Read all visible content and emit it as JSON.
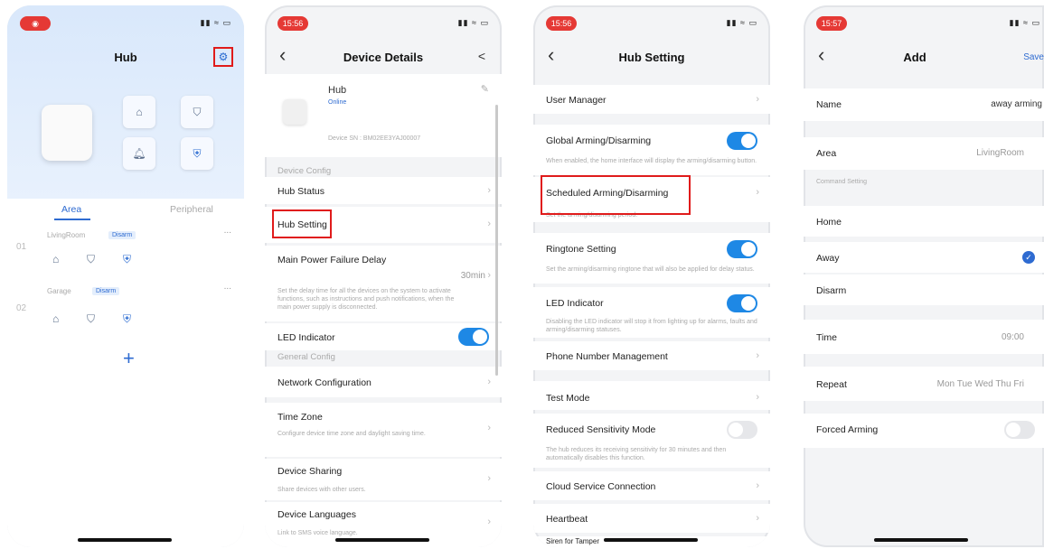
{
  "common": {
    "chevron": "›",
    "back": "‹",
    "system_icons": "▮▮ ≈ ▭"
  },
  "p1": {
    "status_time": "◉",
    "title": "Hub",
    "settings_icon": "⚙",
    "tabs": [
      "Area",
      "Peripheral"
    ],
    "groups": [
      {
        "num": "01",
        "name": "LivingRoom",
        "badge": "Disarm"
      },
      {
        "num": "02",
        "name": "Garage",
        "badge": "Disarm"
      }
    ],
    "ellipsis": "...",
    "add": "+"
  },
  "p2": {
    "status_time": "15:56",
    "title": "Device Details",
    "share_icon": "<",
    "device_name": "Hub",
    "device_status": "Online",
    "device_sn": "Device SN : BM02EE3YAJ00007",
    "edit_icon": "✎",
    "sec_device": "Device Config",
    "hub_status": "Hub Status",
    "hub_setting": "Hub Setting",
    "power_fail": "Main Power Failure Delay",
    "power_fail_value": "30min",
    "power_fail_desc": "Set the delay time for all the devices on the system to activate functions, such as instructions and push notifications, when the main power supply is disconnected.",
    "led": "LED Indicator",
    "sec_general": "General Config",
    "network": "Network Configuration",
    "timezone": "Time Zone",
    "timezone_desc": "Configure device time zone and daylight saving time.",
    "sharing": "Device Sharing",
    "sharing_desc": "Share devices with other users.",
    "languages": "Device Languages",
    "languages_desc": "Link to SMS voice language."
  },
  "p3": {
    "status_time": "15:56",
    "title": "Hub Setting",
    "user_manager": "User Manager",
    "global_arming": "Global Arming/Disarming",
    "global_desc": "When enabled, the home interface will display the arming/disarming button.",
    "scheduled": "Scheduled Arming/Disarming",
    "scheduled_desc": "Set the arming/disarming period.",
    "ringtone": "Ringtone Setting",
    "ringtone_desc": "Set the arming/disarming ringtone that will also be applied for delay status.",
    "led": "LED Indicator",
    "led_desc": "Disabling the LED indicator will stop it from lighting up for alarms, faults and arming/disarming statuses.",
    "phone_mgmt": "Phone Number Management",
    "test_mode": "Test Mode",
    "reduced": "Reduced Sensitivity Mode",
    "reduced_desc": "The hub reduces its receiving sensitivity for 30 minutes and then automatically disables this function.",
    "cloud": "Cloud Service Connection",
    "heartbeat": "Heartbeat",
    "siren": "Siren for Tamper"
  },
  "p4": {
    "status_time": "15:57",
    "title": "Add",
    "save": "Save",
    "name_label": "Name",
    "name_value": "away arming",
    "area_label": "Area",
    "area_value": "LivingRoom",
    "cmd_section": "Command Setting",
    "home": "Home",
    "away": "Away",
    "disarm": "Disarm",
    "check_icon": "✓",
    "time_label": "Time",
    "time_value": "09:00",
    "repeat_label": "Repeat",
    "repeat_value": "Mon Tue Wed Thu Fri",
    "forced": "Forced Arming"
  },
  "colors": {
    "accent": "#1e88e5",
    "highlight": "#e01b1b",
    "badge_bg": "#e4eefc"
  }
}
